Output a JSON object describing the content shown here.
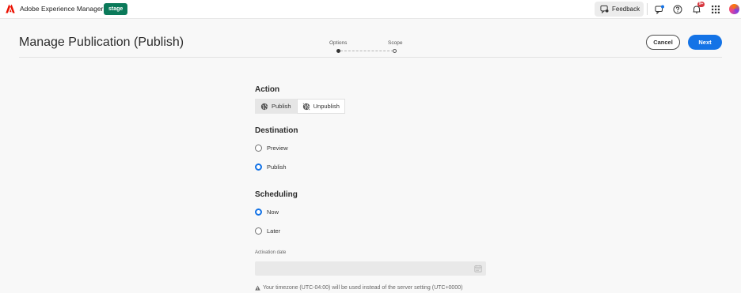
{
  "topbar": {
    "app_name": "Adobe Experience Manager",
    "environment_badge": "stage",
    "feedback_label": "Feedback",
    "notification_count": "9+",
    "icons": [
      "adobe-logo-icon",
      "feedback-icon",
      "announcements-icon",
      "help-icon",
      "bell-icon",
      "apps-grid-icon",
      "user-avatar"
    ]
  },
  "header": {
    "title": "Manage Publication (Publish)",
    "steps": [
      {
        "label": "Options",
        "state": "current"
      },
      {
        "label": "Scope",
        "state": "upcoming"
      }
    ],
    "cancel_label": "Cancel",
    "next_label": "Next"
  },
  "form": {
    "action": {
      "title": "Action",
      "options": [
        {
          "label": "Publish",
          "selected": true
        },
        {
          "label": "Unpublish",
          "selected": false
        }
      ]
    },
    "destination": {
      "title": "Destination",
      "options": [
        {
          "label": "Preview",
          "checked": false
        },
        {
          "label": "Publish",
          "checked": true
        }
      ]
    },
    "scheduling": {
      "title": "Scheduling",
      "options": [
        {
          "label": "Now",
          "checked": true
        },
        {
          "label": "Later",
          "checked": false
        }
      ],
      "activation_date_label": "Activation date",
      "activation_date_value": "",
      "timezone_note": "Your timezone (UTC-04:00) will be used instead of the server setting (UTC+0000)"
    }
  },
  "colors": {
    "accent": "#1473e6",
    "stage_badge": "#0b7a5a",
    "adobe_red": "#eb1000",
    "notification": "#d7373f"
  }
}
